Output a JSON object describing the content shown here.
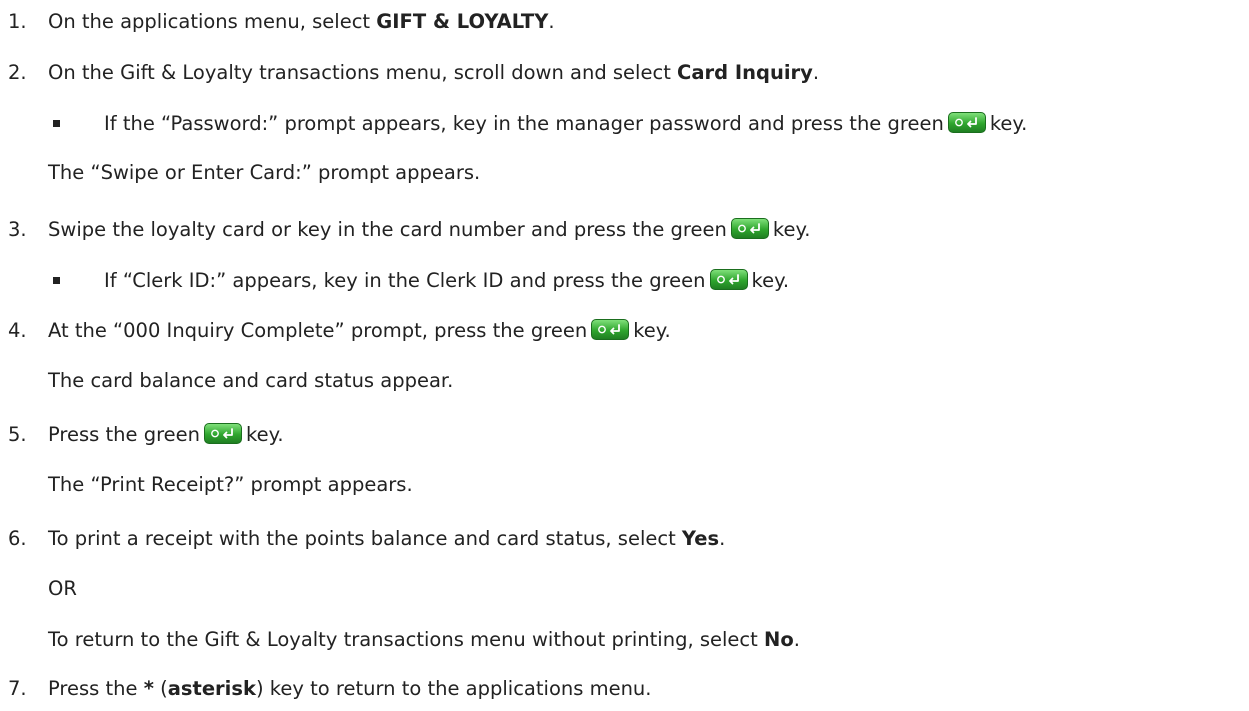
{
  "steps": [
    {
      "num": "1.",
      "pre": "On the applications menu, select ",
      "bold": "GIFT & LOYALTY",
      "post": "."
    },
    {
      "num": "2.",
      "pre": "On the Gift & Loyalty transactions menu, scroll down and select ",
      "bold": "Card Inquiry",
      "post": "."
    },
    {
      "bullet_pre": "If the “Password:” prompt appears, key in the manager password and press the green",
      "bullet_post": "key."
    },
    {
      "note": "The “Swipe or Enter Card:” prompt appears."
    },
    {
      "num": "3.",
      "pre": "Swipe the loyalty card or key in the card number and press the green",
      "post": "key."
    },
    {
      "bullet_pre": "If “Clerk ID:” appears, key in the Clerk ID and press the green",
      "bullet_post": "key."
    },
    {
      "num": "4.",
      "pre": "At the “000 Inquiry Complete” prompt, press the green",
      "post": "key."
    },
    {
      "note": "The card balance and card status appear."
    },
    {
      "num": "5.",
      "pre": "Press the green",
      "post": "key."
    },
    {
      "note": "The “Print Receipt?” prompt appears."
    },
    {
      "num": "6.",
      "pre": "To print a receipt with the points balance and card status, select ",
      "bold": "Yes",
      "post": "."
    },
    {
      "note": "OR"
    },
    {
      "pre2": "To return to the Gift & Loyalty transactions menu without printing, select ",
      "bold2": "No",
      "post2": "."
    },
    {
      "num": "7.",
      "pre": "Press the ",
      "bold": "*",
      "mid": " (",
      "bold_b": "asterisk",
      "post": ") key to return to the applications menu."
    }
  ],
  "icons": {
    "enter_key": "green-enter-key-icon"
  },
  "colors": {
    "text": "#222222",
    "key_green": "#2fa62e"
  }
}
